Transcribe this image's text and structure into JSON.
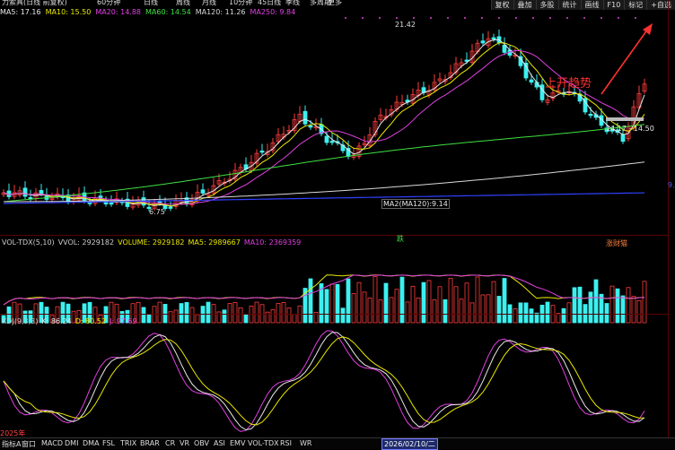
{
  "header": {
    "title": "力索具(日线 前复权)",
    "periods": [
      "60分钟",
      "日线",
      "周线",
      "月线",
      "10分钟",
      "45日线",
      "季线",
      "多周期",
      "更多"
    ],
    "buttons": [
      "复权",
      "叠加",
      "多股",
      "统计",
      "画线",
      "F10",
      "标记",
      "+自选"
    ]
  },
  "ma_legend": [
    {
      "text": "MA5: 17.16",
      "color": "#e8e8e8"
    },
    {
      "text": "MA10: 15.50",
      "color": "#e8e800"
    },
    {
      "text": "MA20: 14.88",
      "color": "#e040e0"
    },
    {
      "text": "MA60: 14.54",
      "color": "#40e040"
    },
    {
      "text": "MA120: 11.26",
      "color": "#d8d8d8"
    },
    {
      "text": "MA250: 9.84",
      "color": "#e040e0"
    }
  ],
  "price_panel": {
    "high_label": "21.42",
    "low_label": "6.75",
    "ma2_label": "MA2(MA120):9.14",
    "range_label": "14.17 - 14.50",
    "annotation": "上开趋势",
    "axis_marker": "9."
  },
  "volume_panel": {
    "legend": [
      {
        "text": "VOL-TDX(5,10)",
        "color": "#cccccc"
      },
      {
        "text": "VVOL: 2929182",
        "color": "#cccccc"
      },
      {
        "text": "VOLUME: 2929182",
        "color": "#e8e800"
      },
      {
        "text": "MA5: 2989667",
        "color": "#e8e800"
      },
      {
        "text": "MA10: 2369359",
        "color": "#e040e0"
      }
    ],
    "event_tag": "跌",
    "event_tag2": "涨财猫"
  },
  "kdj_panel": {
    "legend": [
      {
        "text": "KDJ(9,3,3)",
        "color": "#cccccc"
      },
      {
        "text": "K: 86.24",
        "color": "#e8e8e8"
      },
      {
        "text": "D: 80.52",
        "color": "#e8e800"
      },
      {
        "text": "J: 97.69",
        "color": "#e040e0"
      }
    ],
    "year_label": "2025年"
  },
  "bottom_tabs": [
    "指标A",
    "窗口",
    "MACD",
    "DMI",
    "DMA",
    "FSL",
    "TRIX",
    "BRAR",
    "CR",
    "VR",
    "OBV",
    "ASI",
    "EMV",
    "VOL-TDX",
    "RSI",
    "WR"
  ],
  "date_label": "2026/02/10/二",
  "colors": {
    "up": "#ff3c3c",
    "down": "#3cf0f0",
    "ma5": "#e8e8e8",
    "ma10": "#e8e800",
    "ma20": "#e040e0",
    "ma60": "#40e040",
    "ma120": "#d8d8d8",
    "ma250": "#3040ff"
  }
}
